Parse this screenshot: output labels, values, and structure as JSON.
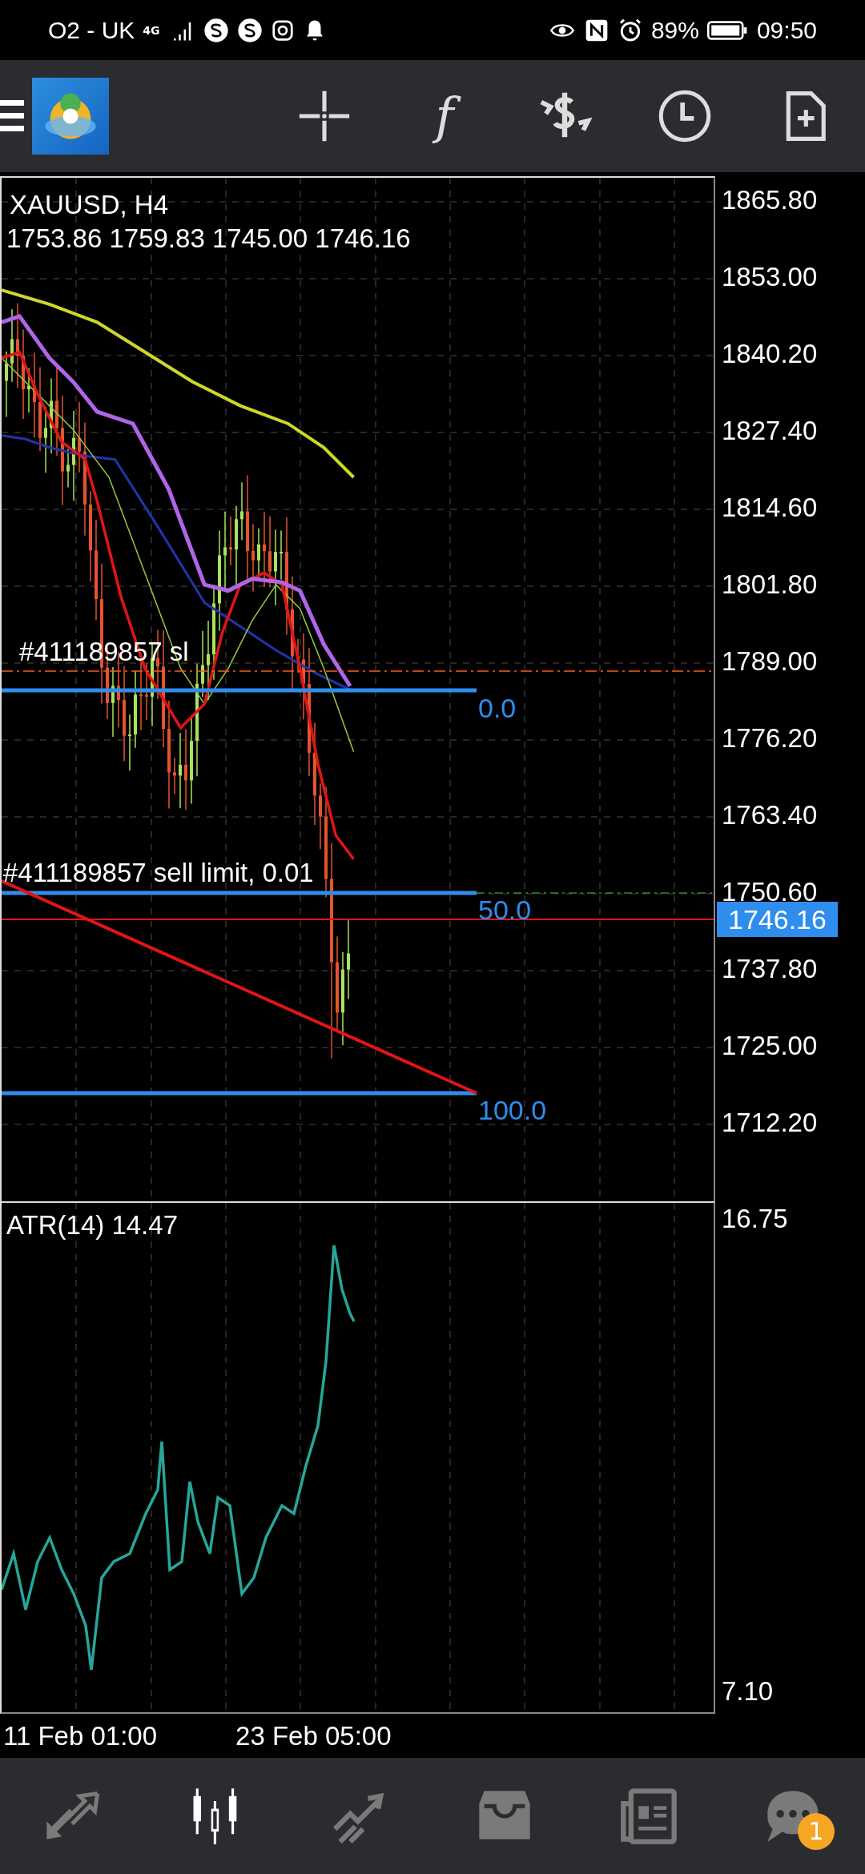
{
  "status_bar": {
    "carrier": "O2 - UK",
    "network": "4G",
    "battery": "89%",
    "time": "09:50"
  },
  "toolbar": {
    "function_glyph": "f"
  },
  "chart": {
    "symbol": "XAUUSD, H4",
    "ohlc": "1753.86 1759.83 1745.00 1746.16",
    "price_axis": [
      "1865.80",
      "1853.00",
      "1840.20",
      "1827.40",
      "1814.60",
      "1801.80",
      "1789.00",
      "1776.20",
      "1763.40",
      "1750.60",
      "1737.80",
      "1725.00",
      "1712.20"
    ],
    "current_price": "1746.16",
    "orders": [
      {
        "label": "#411189857 sl"
      },
      {
        "label": "#411189857 sell limit, 0.01"
      }
    ],
    "fibonacci_levels": [
      "0.0",
      "50.0",
      "100.0"
    ]
  },
  "indicator": {
    "label": "ATR(14) 14.47",
    "axis": [
      "16.75",
      "7.10"
    ]
  },
  "time_axis": [
    "11 Feb 01:00",
    "23 Feb 05:00"
  ],
  "bottom_nav": [
    {
      "selected": false
    },
    {
      "selected": true
    },
    {
      "selected": false
    },
    {
      "selected": false
    },
    {
      "selected": false
    },
    {
      "selected": false,
      "badge": "1"
    }
  ]
}
